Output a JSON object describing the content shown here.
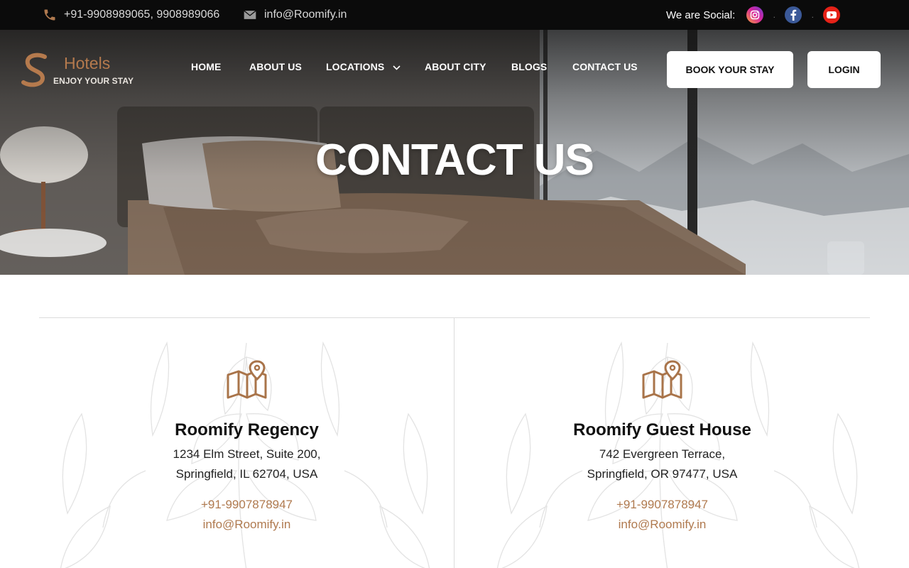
{
  "topbar": {
    "phones": "+91-9908989065, 9908989066",
    "email": "info@Roomify.in",
    "social_label": "We are Social:",
    "social_separator": ".",
    "icons": [
      "phone-icon",
      "envelope-icon",
      "instagram-icon",
      "facebook-icon",
      "youtube-icon"
    ]
  },
  "logo": {
    "brand": "Hotels",
    "tagline": "ENJOY YOUR STAY"
  },
  "nav": {
    "items": [
      "HOME",
      "ABOUT US",
      "LOCATIONS",
      "ABOUT CITY",
      "BLOGS",
      "CONTACT US"
    ],
    "book_button": "BOOK YOUR STAY",
    "login_button": "LOGIN"
  },
  "hero": {
    "title": "CONTACT US"
  },
  "locations": [
    {
      "name": "Roomify Regency",
      "address_line1": "1234 Elm Street, Suite 200,",
      "address_line2": "Springfield, IL 62704, USA",
      "phone": "+91-9907878947",
      "email": "info@Roomify.in"
    },
    {
      "name": "Roomify Guest House",
      "address_line1": "742 Evergreen Terrace,",
      "address_line2": "Springfield, OR 97477, USA",
      "phone": "+91-9907878947",
      "email": "info@Roomify.in"
    }
  ],
  "colors": {
    "accent": "#b07a4f",
    "topbar_bg": "#0b0b0b",
    "instagram": "#d6249f",
    "facebook": "#3b5998",
    "youtube": "#e62117"
  }
}
